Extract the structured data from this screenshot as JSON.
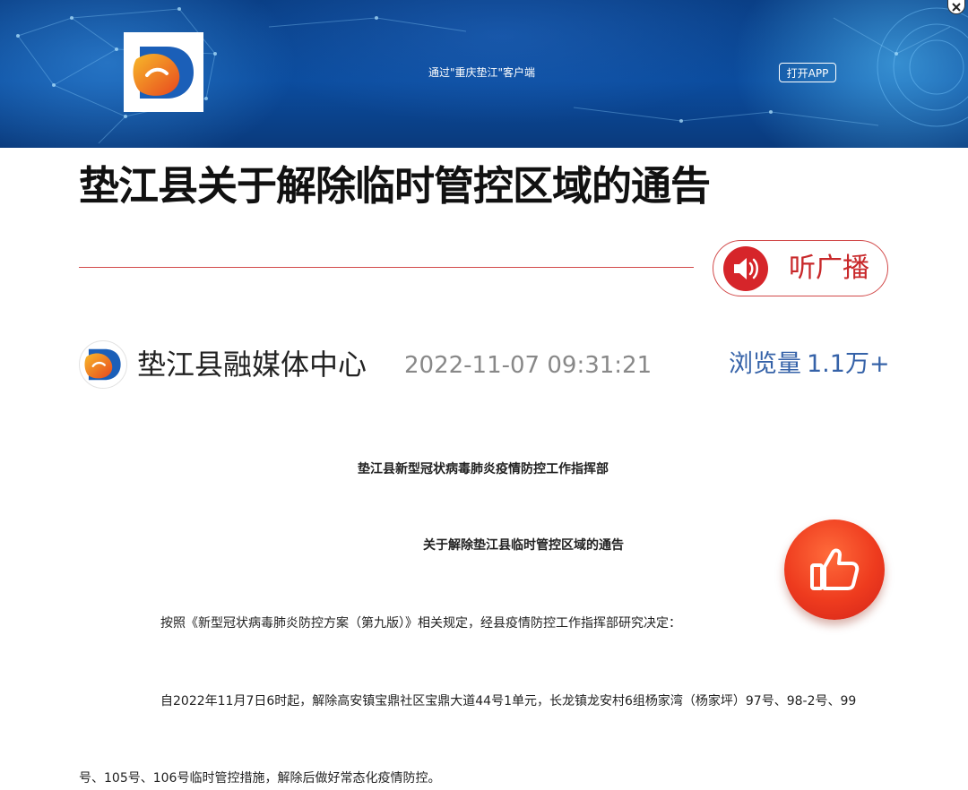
{
  "banner": {
    "prompt_text": "通过\"重庆垫江\"客户端",
    "open_app_label": "打开APP"
  },
  "article": {
    "title": "垫江县关于解除临时管控区域的通告",
    "listen_label": "听广播",
    "source": "垫江县融媒体中心",
    "published": "2022-11-07 09:31:21",
    "views_label": "浏览量",
    "views_count": "1.1万+",
    "issuer": "垫江县新型冠状病毒肺炎疫情防控工作指挥部",
    "notice_title": "关于解除垫江县临时管控区域的通告",
    "paragraph1": "按照《新型冠状病毒肺炎防控方案（第九版）》相关规定，经县疫情防控工作指挥部研究决定：",
    "paragraph2_line1": "自2022年11月7日6时起，解除高安镇宝鼎社区宝鼎大道44号1单元，长龙镇龙安村6组杨家湾（杨家坪）97号、98-2号、99",
    "paragraph2_line2": "号、105号、106号临时管控措施，解除后做好常态化疫情防控。"
  },
  "icons": {
    "logo": "app-logo-icon",
    "close": "close-icon",
    "speaker": "speaker-icon",
    "like": "thumbs-up-icon"
  },
  "colors": {
    "banner_blue": "#0b4c9e",
    "accent_red": "#d24a4a",
    "like_red": "#ee3b1e",
    "views_blue": "#3562a8",
    "logo_orange": "#f39a1f",
    "logo_blue": "#1b5fb8"
  }
}
